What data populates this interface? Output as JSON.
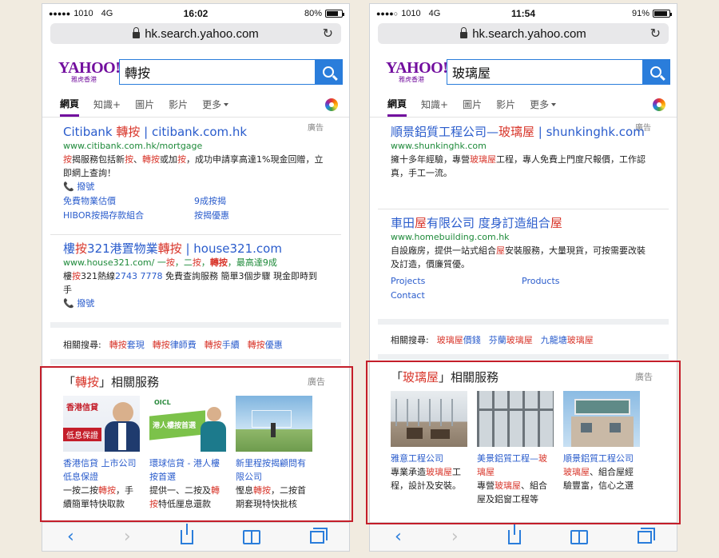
{
  "left": {
    "status": {
      "signal": "●●●●●",
      "carrier": "1010",
      "network": "4G",
      "time": "16:02",
      "battery": "80%",
      "battery_level": 0.8
    },
    "url": "hk.search.yahoo.com",
    "logo": {
      "word": "YAHOO!",
      "sub": "雅虎香港"
    },
    "query": "轉按",
    "tabs": [
      "網頁",
      "知識+",
      "圖片",
      "影片",
      "更多"
    ],
    "results": [
      {
        "ad": "廣告",
        "title": [
          "Citibank ",
          "轉按",
          " | citibank.com.hk"
        ],
        "url": "www.citibank.com.hk/mortgage",
        "desc": [
          "按",
          "揭服務包括新",
          "按",
          "、",
          "轉按",
          "或加",
          "按",
          "，成功申請享高達1%現金回贈，立即網上查詢！"
        ],
        "call": "撥號",
        "links": [
          "免費物業估價",
          "9成按揭",
          "HIBOR按揭存款組合",
          "按揭優惠"
        ]
      },
      {
        "title": [
          "樓",
          "按",
          "321港置物業",
          "轉按",
          " | house321.com"
        ],
        "url": [
          "www.house321.com/ 一",
          "按",
          "，二",
          "按",
          "，",
          "轉按",
          "，最高達9成"
        ],
        "desc": [
          "樓",
          "按",
          "321熱線",
          "2743 7778",
          " 免費查詢服務 簡單3個步驟 現金即時到手"
        ],
        "call": "撥號"
      }
    ],
    "related": {
      "label": "相關搜尋:",
      "items": [
        [
          "轉按",
          "套現"
        ],
        [
          "轉按",
          "律師費"
        ],
        [
          "轉按",
          "手續"
        ],
        [
          "轉按",
          "優惠"
        ]
      ]
    },
    "services": {
      "open": "「",
      "keyword": "轉按",
      "close": "」相關服務",
      "ad": "廣告",
      "cards": [
        {
          "title": "香港信貸 上市公司 低息保證",
          "desc": [
            "一按二按",
            "轉按",
            "，手續簡單特快取款"
          ],
          "banner1": "香港信貸",
          "banner2": "低息保證"
        },
        {
          "title": "環球信貸 - 港人樓按首選",
          "desc": [
            "提供一、二按及",
            "轉按",
            "特低厘息還款"
          ],
          "banner1": "港人樓按首選",
          "banner2": "OICL"
        },
        {
          "title": "新里程按揭顧問有限公司",
          "desc": [
            "慳息",
            "轉按",
            "，二按首期套現特快批核"
          ]
        }
      ]
    }
  },
  "right": {
    "status": {
      "signal": "●●●●○",
      "carrier": "1010",
      "network": "4G",
      "time": "11:54",
      "battery": "91%",
      "battery_level": 0.91
    },
    "url": "hk.search.yahoo.com",
    "logo": {
      "word": "YAHOO!",
      "sub": "雅虎香港"
    },
    "query": "玻璃屋",
    "tabs": [
      "網頁",
      "知識+",
      "圖片",
      "影片",
      "更多"
    ],
    "results": [
      {
        "ad": "廣告",
        "title": [
          "順景鋁質工程公司—",
          "玻璃屋",
          " | shunkinghk.com"
        ],
        "url": "www.shunkinghk.com",
        "desc": [
          "擁十多年經驗，專營",
          "玻璃屋",
          "工程，專人免費上門度尺報價，工作認真，手工一流。"
        ]
      },
      {
        "title": [
          "車田",
          "屋",
          "有限公司 度身訂造組合",
          "屋"
        ],
        "url": "www.homebuilding.com.hk",
        "desc": [
          "自設廠房，提供一站式組合",
          "屋",
          "安裝服務，大量現貨，可按需要改裝及訂造，價廉質優。"
        ],
        "links": [
          "Projects",
          "Products",
          "Contact"
        ]
      }
    ],
    "related": {
      "label": "相關搜尋:",
      "items": [
        [
          "玻璃屋",
          "價錢"
        ],
        [
          "芬蘭",
          "玻璃屋"
        ],
        [
          "九龍塘",
          "玻璃屋"
        ]
      ]
    },
    "services": {
      "open": "「",
      "keyword": "玻璃屋",
      "close": "」相關服務",
      "ad": "廣告",
      "cards": [
        {
          "title": "雅意工程公司",
          "desc": [
            "專業承造",
            "玻璃屋",
            "工程，設計及安裝。"
          ]
        },
        {
          "title": [
            "美景鋁質工程—",
            "玻璃屋"
          ],
          "desc": [
            "專營",
            "玻璃屋",
            "、組合屋及鋁窗工程等"
          ]
        },
        {
          "title": "順景鋁質工程公司",
          "desc": [
            "玻璃屋",
            "、組合屋經驗豐富，信心之選"
          ]
        }
      ]
    }
  },
  "colors": {
    "yahoo_purple": "#720e9e",
    "link_blue": "#2a5ccc",
    "url_green": "#1e8a3a",
    "highlight_red": "#d8352a",
    "frame_red": "#c41e2a"
  }
}
